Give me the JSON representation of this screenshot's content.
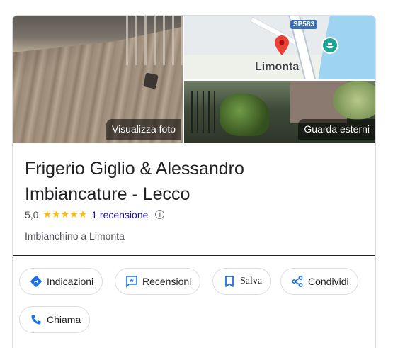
{
  "photos": {
    "main_label": "Visualizza foto",
    "exterior_label": "Guarda esterni",
    "map": {
      "route_tag": "SP583",
      "town": "Limonta"
    }
  },
  "business": {
    "name": "Frigerio Giglio & Alessandro Imbiancature - Lecco",
    "rating_value": "5,0",
    "stars": "★★★★★",
    "reviews_label": "1 recensione",
    "category": "Imbianchino a Limonta"
  },
  "actions": {
    "directions": "Indicazioni",
    "reviews": "Recensioni",
    "save": "Salva",
    "share": "Condividi",
    "call": "Chiama"
  },
  "colors": {
    "accent_blue": "#1a73e8",
    "star_yellow": "#fbbc04",
    "link": "#1a0dab",
    "pin_red": "#ea4335",
    "ferry_teal": "#1aa594"
  },
  "icons": {
    "directions": "directions-icon",
    "reviews": "reviews-icon",
    "save": "bookmark-icon",
    "share": "share-icon",
    "call": "phone-icon",
    "info": "info-icon"
  }
}
